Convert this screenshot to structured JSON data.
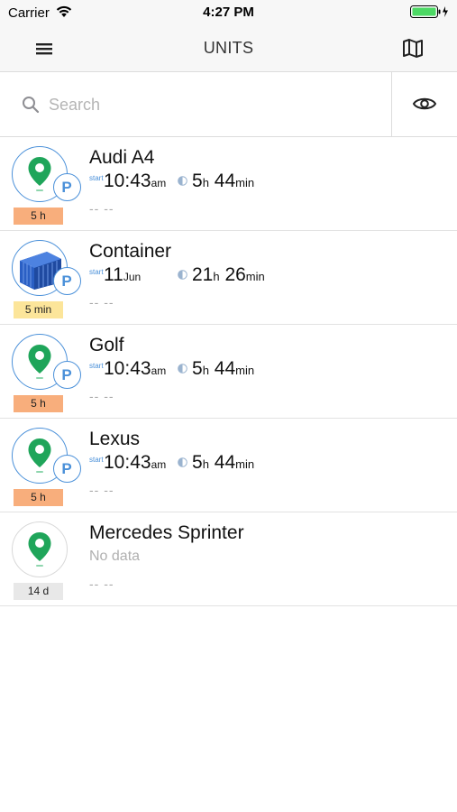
{
  "status_bar": {
    "carrier": "Carrier",
    "time": "4:27 PM"
  },
  "nav": {
    "title": "UNITS",
    "menu_icon": "hamburger-menu-icon",
    "map_icon": "map-icon"
  },
  "search": {
    "placeholder": "Search",
    "value": "",
    "visibility_icon": "eye-icon"
  },
  "colors": {
    "accent": "#4a90d9",
    "pin": "#1fa55a",
    "badge_orange": "#f8ae7c",
    "badge_yellow": "#fce59a",
    "badge_gray": "#e8e8e8"
  },
  "units": [
    {
      "name": "Audi A4",
      "icon": "location-pin-icon",
      "parked": "P",
      "age": "5 h",
      "start_label": "start",
      "start_main": "10:43",
      "start_suffix": "am",
      "dur_a": "5",
      "dur_a_unit": "h",
      "dur_b": "44",
      "dur_b_unit": "min",
      "footer": "-- --"
    },
    {
      "name": "Container",
      "icon": "shipping-container-image",
      "parked": "P",
      "age": "5 min",
      "start_label": "start",
      "start_main": "11",
      "start_suffix": "Jun",
      "dur_a": "21",
      "dur_a_unit": "h",
      "dur_b": "26",
      "dur_b_unit": "min",
      "footer": "-- --"
    },
    {
      "name": "Golf",
      "icon": "location-pin-icon",
      "parked": "P",
      "age": "5 h",
      "start_label": "start",
      "start_main": "10:43",
      "start_suffix": "am",
      "dur_a": "5",
      "dur_a_unit": "h",
      "dur_b": "44",
      "dur_b_unit": "min",
      "footer": "-- --"
    },
    {
      "name": "Lexus",
      "icon": "location-pin-icon",
      "parked": "P",
      "age": "5 h",
      "start_label": "start",
      "start_main": "10:43",
      "start_suffix": "am",
      "dur_a": "5",
      "dur_a_unit": "h",
      "dur_b": "44",
      "dur_b_unit": "min",
      "footer": "-- --"
    },
    {
      "name": "Mercedes Sprinter",
      "icon": "location-pin-icon",
      "no_data": "No data",
      "age": "14 d",
      "footer": "-- --"
    }
  ]
}
